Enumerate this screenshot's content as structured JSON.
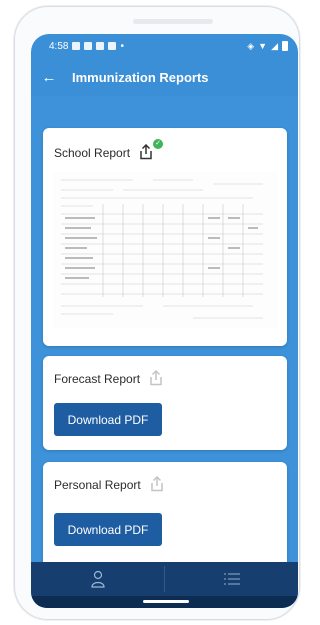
{
  "status": {
    "time": "4:58"
  },
  "appbar": {
    "title": "Immunization Reports"
  },
  "cards": [
    {
      "title": "School Report",
      "shared": true
    },
    {
      "title": "Forecast Report",
      "button": "Download PDF"
    },
    {
      "title": "Personal Report",
      "button": "Download PDF"
    }
  ],
  "bottom_nav": [
    {
      "icon": "person-icon"
    },
    {
      "icon": "menu-icon"
    }
  ],
  "colors": {
    "header": "#3a8fd6",
    "button": "#1f5da3",
    "bottom_nav": "#163e6e",
    "success": "#3fb55a"
  }
}
